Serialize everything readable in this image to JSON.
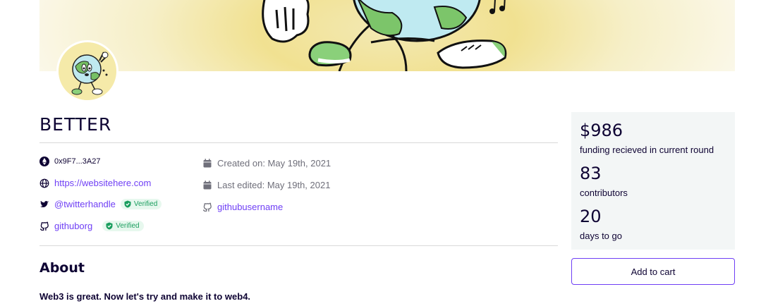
{
  "project": {
    "title": "BETTER",
    "description": "Web3 is great. Now let's try and make it to web4."
  },
  "meta_left": {
    "address": "0x9F7...3A27",
    "website": "https://websitehere.com",
    "twitter": "@twitterhandle",
    "twitter_badge": "Verified",
    "github_org": "githuborg",
    "github_badge": "Verified"
  },
  "meta_right": {
    "created": "Created on: May 19th, 2021",
    "edited": "Last edited: May 19th, 2021",
    "github_user": "githubusername"
  },
  "about": {
    "heading": "About"
  },
  "stats": {
    "funding": {
      "value": "$986",
      "label": "funding recieved in current round"
    },
    "contributors": {
      "value": "83",
      "label": "contributors"
    },
    "days": {
      "value": "20",
      "label": "days to go"
    }
  },
  "cart": {
    "label": "Add to cart"
  },
  "colors": {
    "accent": "#6f3ff5",
    "text": "#0e0333",
    "verified": "#1a9e5e",
    "stats_bg": "#f3f6f6"
  },
  "icons": [
    "ethereum-icon",
    "globe-icon",
    "twitter-icon",
    "github-icon",
    "shield-check-icon",
    "calendar-icon"
  ]
}
